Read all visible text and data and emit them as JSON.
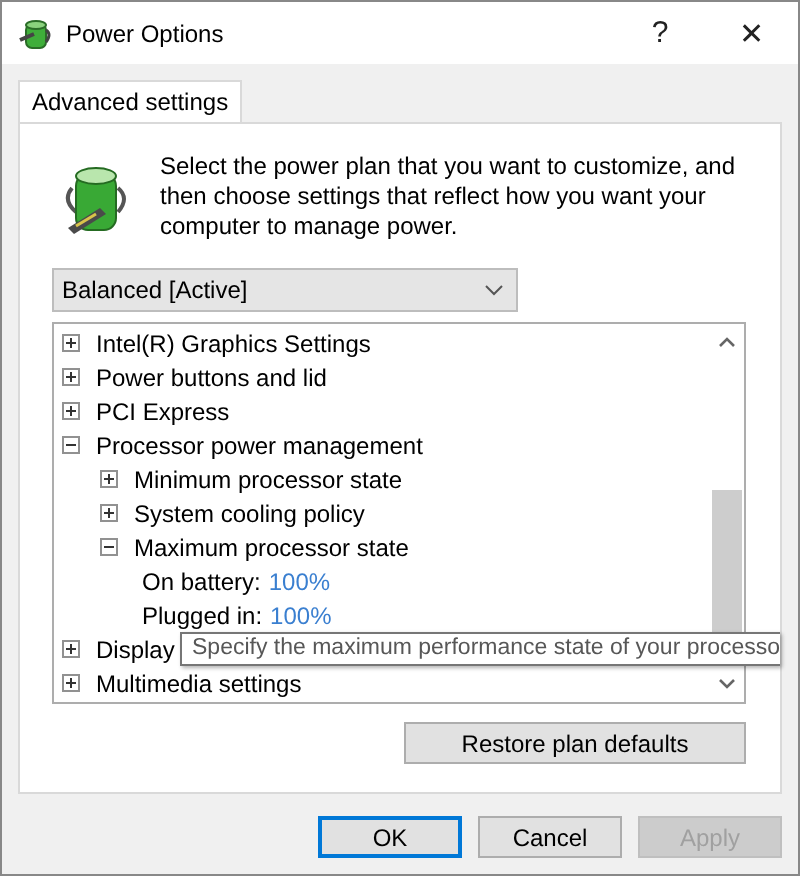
{
  "window": {
    "title": "Power Options",
    "help": "?",
    "close": "✕"
  },
  "tabs": [
    {
      "label": "Advanced settings",
      "selected": true
    }
  ],
  "intro": "Select the power plan that you want to customize, and then choose settings that reflect how you want your computer to manage power.",
  "plan_dropdown": {
    "value": "Balanced [Active]"
  },
  "tree": [
    {
      "kind": "group",
      "label": "Intel(R) Graphics Settings",
      "expanded": false
    },
    {
      "kind": "group",
      "label": "Power buttons and lid",
      "expanded": false
    },
    {
      "kind": "group",
      "label": "PCI Express",
      "expanded": false
    },
    {
      "kind": "group",
      "label": "Processor power management",
      "expanded": true,
      "children": [
        {
          "kind": "group",
          "label": "Minimum processor state",
          "expanded": false
        },
        {
          "kind": "group",
          "label": "System cooling policy",
          "expanded": false
        },
        {
          "kind": "group",
          "label": "Maximum processor state",
          "expanded": true,
          "children": [
            {
              "kind": "setting",
              "label": "On battery:",
              "value": "100%"
            },
            {
              "kind": "setting",
              "label": "Plugged in:",
              "value": "100%"
            }
          ]
        }
      ]
    },
    {
      "kind": "group",
      "label": "Display",
      "expanded": false
    },
    {
      "kind": "group",
      "label": "Multimedia settings",
      "expanded": false
    }
  ],
  "tooltip": "Specify the maximum performance state of your processo",
  "restore_button": "Restore plan defaults",
  "buttons": [
    {
      "label": "OK",
      "disabled": false,
      "default": true
    },
    {
      "label": "Cancel",
      "disabled": false,
      "default": false
    },
    {
      "label": "Apply",
      "disabled": true,
      "default": false
    }
  ]
}
